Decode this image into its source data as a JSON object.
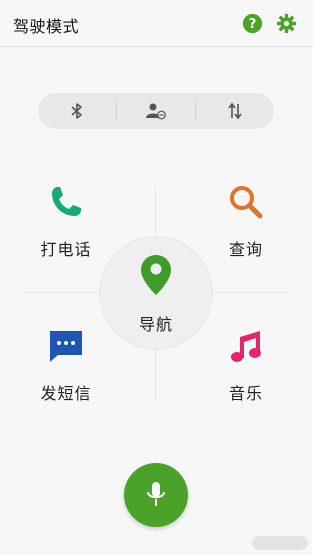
{
  "header": {
    "title": "驾驶模式",
    "help_icon": "help-circle-icon",
    "settings_icon": "gear-icon"
  },
  "toggles": [
    {
      "icon": "bluetooth-icon"
    },
    {
      "icon": "contact-block-icon"
    },
    {
      "icon": "data-transfer-icon"
    }
  ],
  "tiles": {
    "call": {
      "label": "打电话",
      "icon": "phone-icon"
    },
    "search": {
      "label": "查询",
      "icon": "search-icon"
    },
    "navigation": {
      "label": "导航",
      "icon": "location-pin-icon"
    },
    "sms": {
      "label": "发短信",
      "icon": "message-icon"
    },
    "music": {
      "label": "音乐",
      "icon": "music-note-icon"
    }
  },
  "voice": {
    "icon": "microphone-icon"
  },
  "colors": {
    "accent_green": "#4aa328",
    "phone_green": "#19a974",
    "search_orange": "#e0742a",
    "message_blue": "#1f56b4",
    "music_pink": "#e3256c",
    "nav_green": "#3f9b2a"
  }
}
